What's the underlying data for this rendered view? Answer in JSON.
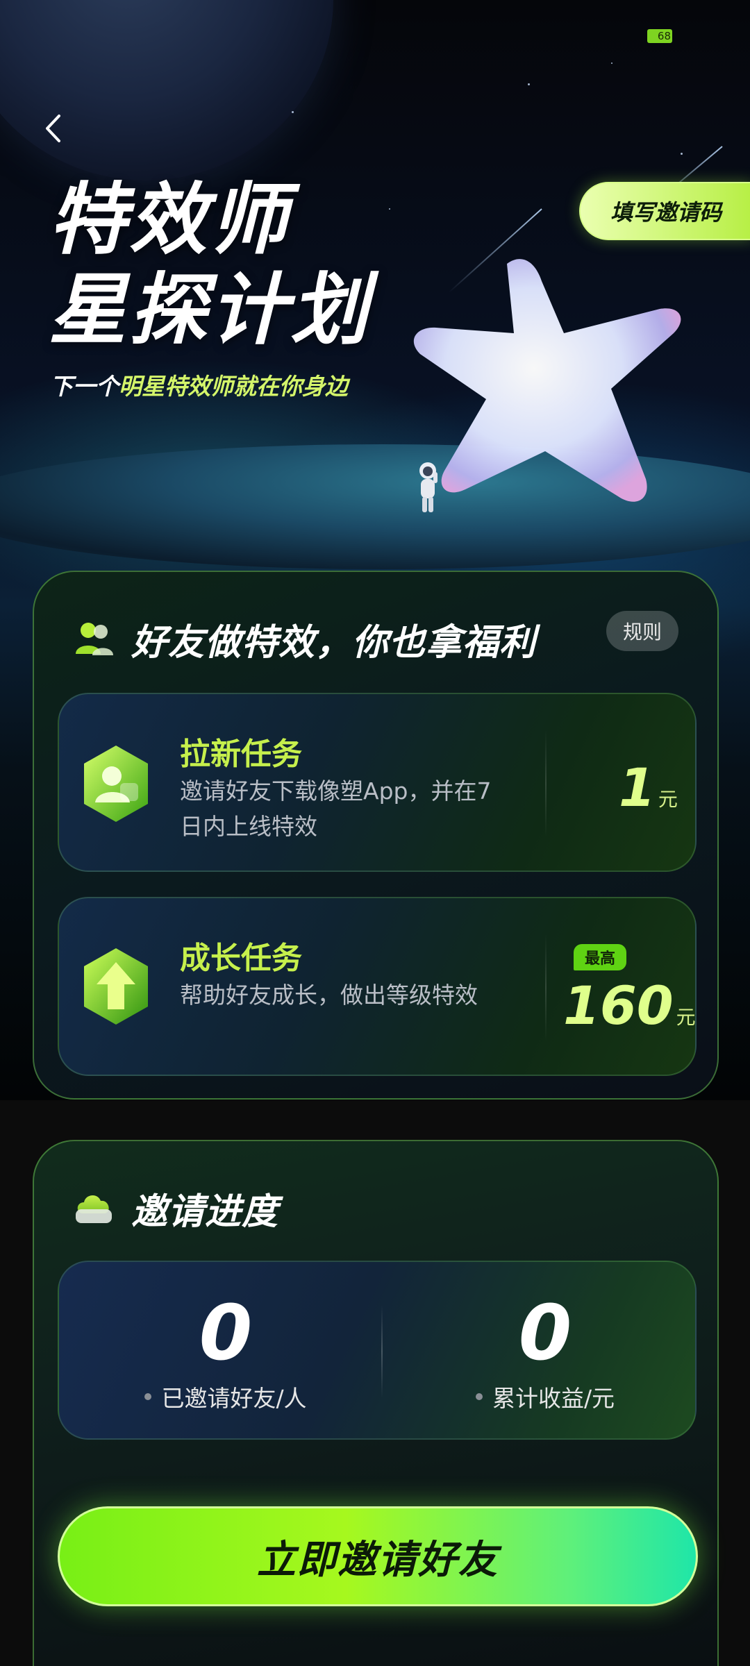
{
  "status_bar": {
    "battery": "68"
  },
  "hero": {
    "title_line1": "特效师",
    "title_line2": "星探计划",
    "subtitle_pre": "下一个",
    "subtitle_hl": "明星特效师就在你身边",
    "invite_code_button": "填写邀请码"
  },
  "tasks_card": {
    "title": "好友做特效，你也拿福利",
    "rules_label": "规则",
    "tasks": [
      {
        "name": "拉新任务",
        "desc": "邀请好友下载像塑App，并在7日内上线特效",
        "amount": "1",
        "unit": "元",
        "badge": ""
      },
      {
        "name": "成长任务",
        "desc": "帮助好友成长，做出等级特效",
        "amount": "160",
        "unit": "元",
        "badge": "最高"
      }
    ]
  },
  "progress_card": {
    "title": "邀请进度",
    "stats": [
      {
        "value": "0",
        "label": "已邀请好友/人"
      },
      {
        "value": "0",
        "label": "累计收益/元"
      }
    ],
    "cta_label": "立即邀请好友"
  },
  "colors": {
    "accent_green": "#c6f04c",
    "amount_yellow": "#dfff8c",
    "cta_gradient_start": "#78ef16",
    "cta_gradient_end": "#1fe6a8"
  }
}
